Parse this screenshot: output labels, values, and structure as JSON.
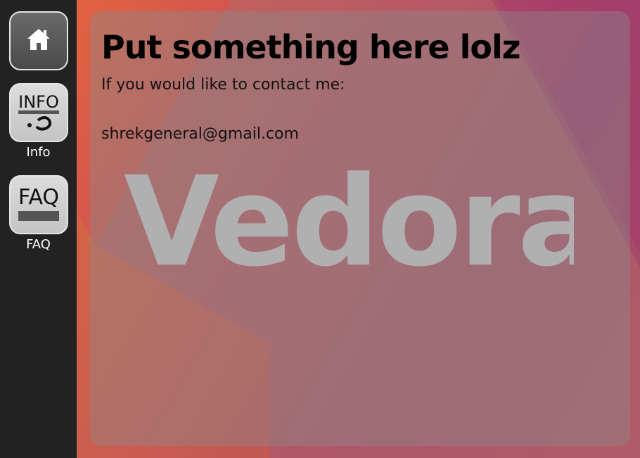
{
  "sidebar": {
    "items": [
      {
        "label": "",
        "icon": "home-icon"
      },
      {
        "label": "Info",
        "icon": "info-icon",
        "icon_text": "INFO"
      },
      {
        "label": "FAQ",
        "icon": "faq-icon",
        "icon_text": "FAQ"
      }
    ]
  },
  "main": {
    "title": "Put something here lolz",
    "contact_intro": "If you would like to contact me:",
    "email": "shrekgeneral@gmail.com",
    "watermark": "Vedora"
  },
  "colors": {
    "sidebar_bg": "#222222",
    "accent_orange": "#e8693a",
    "accent_magenta": "#a8406a",
    "panel_overlay": "#8a8a8a",
    "watermark": "#b0b0b0"
  }
}
